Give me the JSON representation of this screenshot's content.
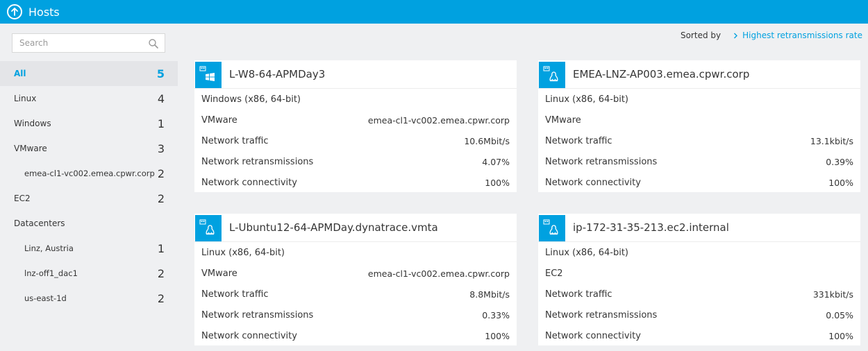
{
  "header": {
    "title": "Hosts"
  },
  "search": {
    "placeholder": "Search"
  },
  "sidebar": {
    "items": [
      {
        "label": "All",
        "count": "5"
      },
      {
        "label": "Linux",
        "count": "4"
      },
      {
        "label": "Windows",
        "count": "1"
      },
      {
        "label": "VMware",
        "count": "3"
      },
      {
        "label": "emea-cl1-vc002.emea.cpwr.corp",
        "count": "2"
      },
      {
        "label": "EC2",
        "count": "2"
      },
      {
        "label": "Datacenters",
        "count": ""
      },
      {
        "label": "Linz, Austria",
        "count": "1"
      },
      {
        "label": "lnz-off1_dac1",
        "count": "2"
      },
      {
        "label": "us-east-1d",
        "count": "2"
      }
    ]
  },
  "sort": {
    "label": "Sorted by",
    "value": "Highest retransmissions rate"
  },
  "colors": {
    "accent": "#00a1e0",
    "background": "#eff0f2"
  },
  "hosts": [
    {
      "name": "L-W8-64-APMDay3",
      "icon": "windows-icon",
      "os": "Windows (x86, 64-bit)",
      "platform": "VMware",
      "platform_detail": "emea-cl1-vc002.emea.cpwr.corp",
      "rows": [
        {
          "label": "Network traffic",
          "value": "10.6Mbit/s"
        },
        {
          "label": "Network retransmissions",
          "value": "4.07%"
        },
        {
          "label": "Network connectivity",
          "value": "100%"
        }
      ]
    },
    {
      "name": "EMEA-LNZ-AP003.emea.cpwr.corp",
      "icon": "linux-icon",
      "os": "Linux (x86, 64-bit)",
      "platform": "VMware",
      "platform_detail": "",
      "rows": [
        {
          "label": "Network traffic",
          "value": "13.1kbit/s"
        },
        {
          "label": "Network retransmissions",
          "value": "0.39%"
        },
        {
          "label": "Network connectivity",
          "value": "100%"
        }
      ]
    },
    {
      "name": "L-Ubuntu12-64-APMDay.dynatrace.vmta",
      "icon": "linux-icon",
      "os": "Linux (x86, 64-bit)",
      "platform": "VMware",
      "platform_detail": "emea-cl1-vc002.emea.cpwr.corp",
      "rows": [
        {
          "label": "Network traffic",
          "value": "8.8Mbit/s"
        },
        {
          "label": "Network retransmissions",
          "value": "0.33%"
        },
        {
          "label": "Network connectivity",
          "value": "100%"
        }
      ]
    },
    {
      "name": "ip-172-31-35-213.ec2.internal",
      "icon": "linux-icon",
      "os": "Linux (x86, 64-bit)",
      "platform": "EC2",
      "platform_detail": "",
      "rows": [
        {
          "label": "Network traffic",
          "value": "331kbit/s"
        },
        {
          "label": "Network retransmissions",
          "value": "0.05%"
        },
        {
          "label": "Network connectivity",
          "value": "100%"
        }
      ]
    }
  ]
}
